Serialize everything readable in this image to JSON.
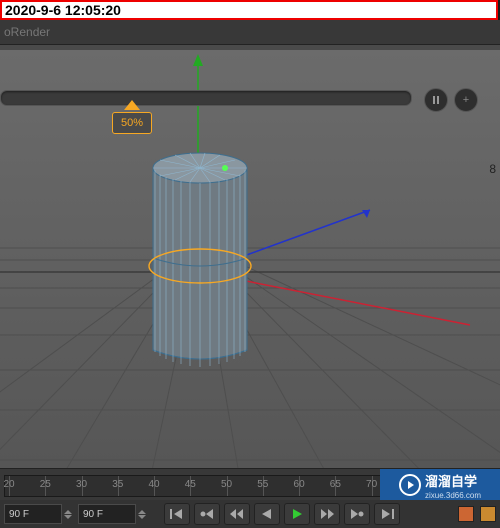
{
  "timestamp": "2020-9-6 12:05:20",
  "titlebar": {
    "label": "oRender"
  },
  "slider": {
    "percent_label": "50%"
  },
  "round_buttons": {
    "plus": "+"
  },
  "viewport": {
    "side_numbers": [
      "8"
    ]
  },
  "timeline": {
    "ticks": [
      20,
      25,
      30,
      35,
      40,
      45,
      50,
      55,
      60,
      65,
      70
    ]
  },
  "overlay": {
    "brand": "溜溜自学",
    "sub": "zixue.3d66.com"
  },
  "playbar": {
    "frame_start": "90 F",
    "frame_end": "90 F"
  }
}
